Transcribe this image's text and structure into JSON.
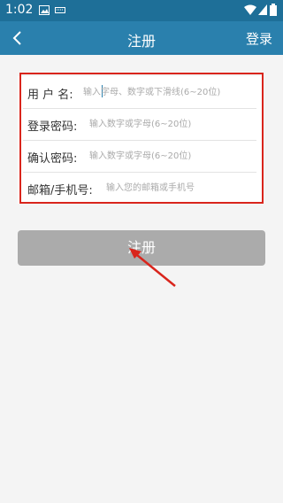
{
  "status_bar": {
    "time": "1:02",
    "icons": [
      "image-icon",
      "keyboard-icon",
      "wifi-icon",
      "signal-icon",
      "battery-icon"
    ]
  },
  "title_bar": {
    "back_icon": "chevron-left-icon",
    "title": "注册",
    "login_label": "登录"
  },
  "form": {
    "username": {
      "label": "用 户 名:",
      "placeholder": "输入字母、数字或下滑线(6~20位)",
      "value": ""
    },
    "password": {
      "label": "登录密码:",
      "placeholder": "输入数字或字母(6~20位)",
      "value": ""
    },
    "confirm_password": {
      "label": "确认密码:",
      "placeholder": "输入数字或字母(6~20位)",
      "value": ""
    },
    "email_phone": {
      "label": "邮箱/手机号:",
      "placeholder": "输入您的邮箱或手机号",
      "value": ""
    }
  },
  "register_button": {
    "label": "注册"
  },
  "colors": {
    "status_bar": "#1e6f98",
    "title_bar": "#2a80ad",
    "button_disabled": "#ababab",
    "annotation_red": "#d9251c"
  }
}
